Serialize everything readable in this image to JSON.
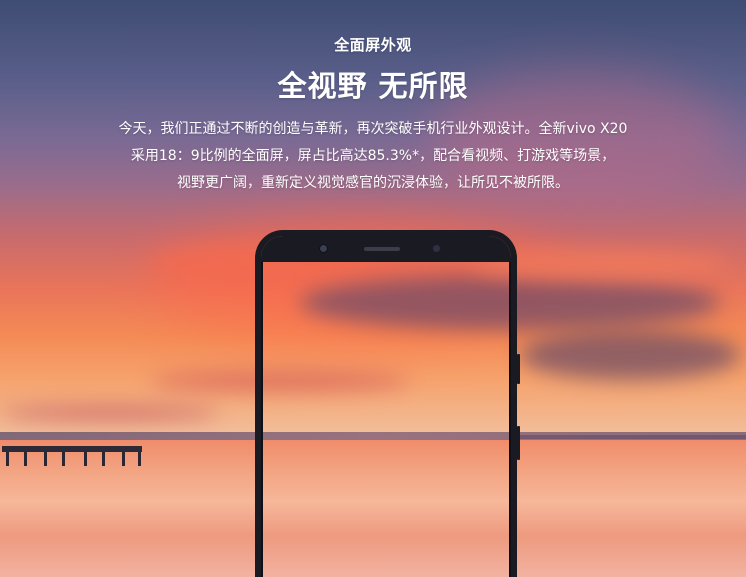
{
  "header": {
    "kicker": "全面屏外观",
    "title": "全视野 无所限"
  },
  "description": {
    "lines": [
      "今天，我们正通过不断的创造与革新，再次突破手机行业外观设计。全新vivo X20",
      "采用18：9比例的全面屏，屏占比高达85.3%*，配合看视频、打游戏等场景，",
      "视野更广阔，重新定义视觉感官的沉浸体验，让所见不被所限。"
    ]
  },
  "colors": {
    "text": "#ffffff",
    "sky_top": "#3f4c73",
    "sunset": "#e9745a",
    "phone_frame": "#1a1b22"
  }
}
